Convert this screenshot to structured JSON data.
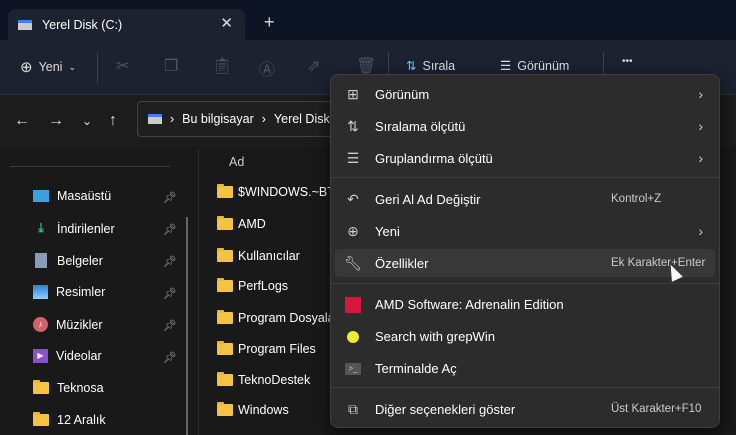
{
  "tab": {
    "title": "Yerel Disk (C:)",
    "close": "✕",
    "new_tab": "+"
  },
  "toolbar": {
    "new_label": "Yeni",
    "sort_label": "Sırala",
    "view_label": "Görünüm",
    "more": "•••"
  },
  "address": {
    "crumbs": [
      "Bu bilgisayar",
      "Yerel Disk (C:)"
    ]
  },
  "sidebar": {
    "items": [
      {
        "label": "Masaüstü",
        "icon": "desktop-icon",
        "pinned": true
      },
      {
        "label": "İndirilenler",
        "icon": "download-icon",
        "pinned": true
      },
      {
        "label": "Belgeler",
        "icon": "documents-icon",
        "pinned": true
      },
      {
        "label": "Resimler",
        "icon": "pictures-icon",
        "pinned": true
      },
      {
        "label": "Müzikler",
        "icon": "music-icon",
        "pinned": true
      },
      {
        "label": "Videolar",
        "icon": "videos-icon",
        "pinned": true
      },
      {
        "label": "Teknosa",
        "icon": "folder-icon"
      },
      {
        "label": "12 Aralık",
        "icon": "folder-icon"
      }
    ]
  },
  "files": {
    "column_header": "Ad",
    "items": [
      "$WINDOWS.~BT",
      "AMD",
      "Kullanıcılar",
      "PerfLogs",
      "Program Dosyaları",
      "Program Files",
      "TeknoDestek",
      "Windows"
    ]
  },
  "menu": {
    "items": [
      {
        "label": "Görünüm",
        "icon": "grid-icon",
        "submenu": true
      },
      {
        "label": "Sıralama ölçütü",
        "icon": "sort-icon",
        "submenu": true
      },
      {
        "label": "Gruplandırma ölçütü",
        "icon": "group-icon",
        "submenu": true
      },
      {
        "label": "Geri Al Ad Değiştir",
        "icon": "undo-icon",
        "shortcut": "Kontrol+Z"
      },
      {
        "label": "Yeni",
        "icon": "add-circle-icon",
        "submenu": true
      },
      {
        "label": "Özellikler",
        "icon": "wrench-icon",
        "shortcut": "Ek Karakter+Enter",
        "highlighted": true
      },
      {
        "label": "AMD Software: Adrenalin Edition",
        "icon": "amd-icon"
      },
      {
        "label": "Search with grepWin",
        "icon": "grepwin-icon"
      },
      {
        "label": "Terminalde Aç",
        "icon": "terminal-icon"
      },
      {
        "label": "Diğer seçenekleri göster",
        "icon": "more-options-icon",
        "shortcut": "Üst Karakter+F10"
      }
    ]
  }
}
